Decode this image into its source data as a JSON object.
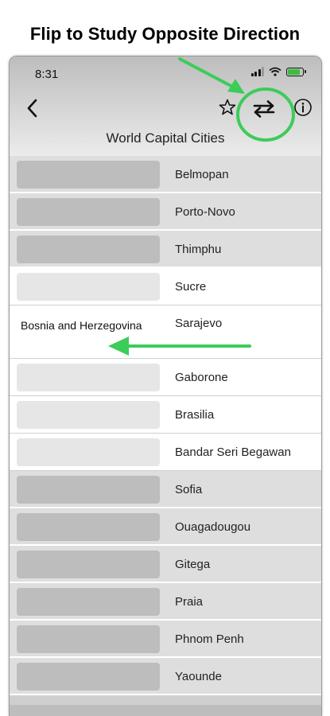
{
  "banner": "Flip to Study Opposite Direction",
  "status": {
    "time": "8:31"
  },
  "nav": {
    "title": "World Capital Cities"
  },
  "colors": {
    "highlight": "#3ccc5a"
  },
  "rows": [
    {
      "capital": "Belmopan",
      "answer": "",
      "state": "hidden"
    },
    {
      "capital": "Porto-Novo",
      "answer": "",
      "state": "hidden"
    },
    {
      "capital": "Thimphu",
      "answer": "",
      "state": "hidden"
    },
    {
      "capital": "Sucre",
      "answer": "",
      "state": "revealed"
    },
    {
      "capital": "Sarajevo",
      "answer": "Bosnia and Herzegovina",
      "state": "open"
    },
    {
      "capital": "Gaborone",
      "answer": "",
      "state": "revealed"
    },
    {
      "capital": "Brasilia",
      "answer": "",
      "state": "revealed"
    },
    {
      "capital": "Bandar Seri Begawan",
      "answer": "",
      "state": "revealed"
    },
    {
      "capital": "Sofia",
      "answer": "",
      "state": "hidden"
    },
    {
      "capital": "Ouagadougou",
      "answer": "",
      "state": "hidden"
    },
    {
      "capital": "Gitega",
      "answer": "",
      "state": "hidden"
    },
    {
      "capital": "Praia",
      "answer": "",
      "state": "hidden"
    },
    {
      "capital": "Phnom Penh",
      "answer": "",
      "state": "hidden"
    },
    {
      "capital": "Yaounde",
      "answer": "",
      "state": "hidden"
    }
  ]
}
